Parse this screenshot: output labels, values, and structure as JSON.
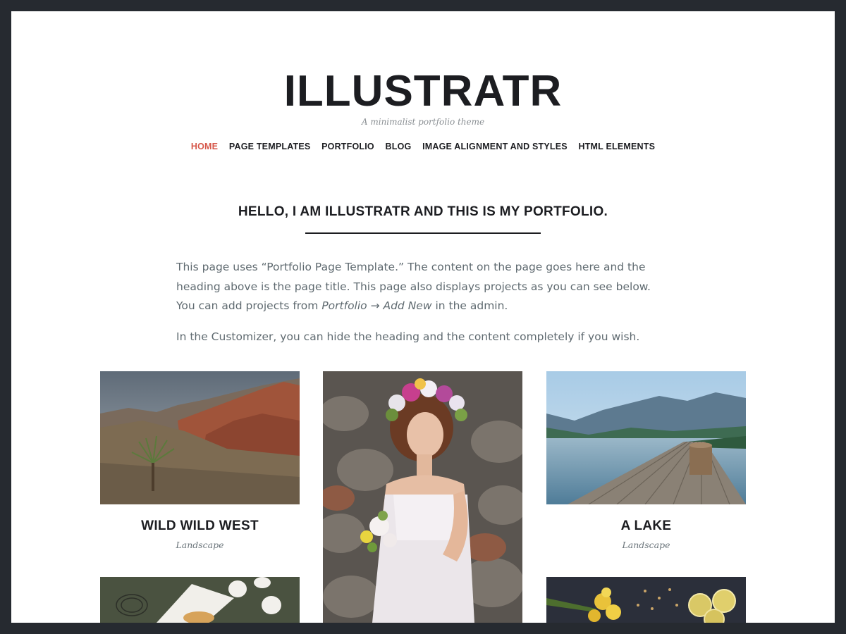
{
  "site": {
    "title": "ILLUSTRATR",
    "tagline": "A minimalist portfolio theme"
  },
  "nav": {
    "items": [
      {
        "label": "HOME",
        "active": true
      },
      {
        "label": "PAGE TEMPLATES",
        "active": false
      },
      {
        "label": "PORTFOLIO",
        "active": false
      },
      {
        "label": "BLOG",
        "active": false
      },
      {
        "label": "IMAGE ALIGNMENT AND STYLES",
        "active": false
      },
      {
        "label": "HTML ELEMENTS",
        "active": false
      }
    ]
  },
  "page": {
    "heading": "HELLO, I AM ILLUSTRATR AND THIS IS MY PORTFOLIO.",
    "para1_a": "This page uses “Portfolio Page Template.” The content on the page goes here and the heading above is the page title. This page also displays projects as you can see below. You can add projects from ",
    "para1_em": "Portfolio → Add New",
    "para1_b": " in the admin.",
    "para2": "In the Customizer, you can hide the heading and the content completely if you wish."
  },
  "projects": [
    {
      "title": "WILD WILD WEST",
      "category": "Landscape",
      "image": "desert-canyon-photo"
    },
    {
      "title": "",
      "category": "",
      "image": "flower-crown-woman-photo"
    },
    {
      "title": "A LAKE",
      "category": "Landscape",
      "image": "lake-pier-photo"
    },
    {
      "title": "",
      "category": "",
      "image": "eggs-kitchen-photo"
    },
    {
      "title": "",
      "category": "",
      "image": "lemons-flowers-photo"
    }
  ],
  "colors": {
    "accent": "#d6574a",
    "text_dark": "#1c1d21",
    "text_body": "#5f6a70",
    "frame": "#262a30"
  }
}
